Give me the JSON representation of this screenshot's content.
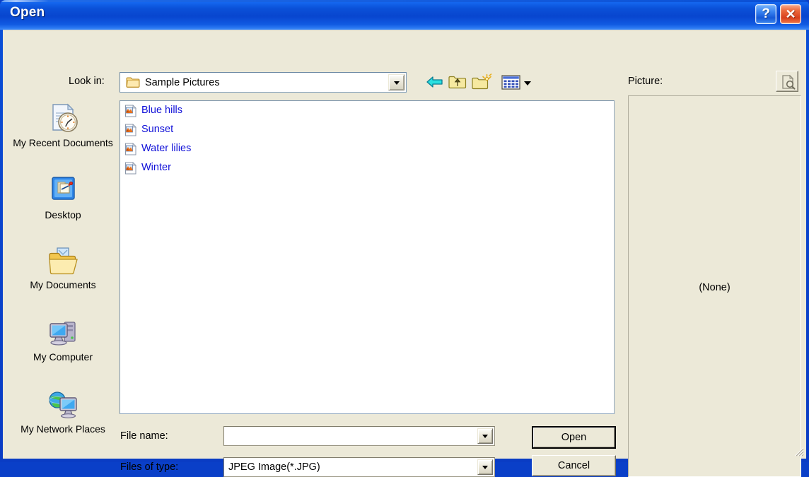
{
  "window": {
    "title": "Open",
    "help_button": "?",
    "close_button": "✕",
    "accent_titlebar": "#0b51d8",
    "dialog_background": "#ece9d8",
    "link_color": "#1010d8"
  },
  "toolbar": {
    "lookin_label": "Look in:",
    "lookin_value": "Sample Pictures",
    "buttons": [
      {
        "name": "back-button",
        "icon": "back-arrow-icon",
        "tooltip": "Back"
      },
      {
        "name": "up-one-level-button",
        "icon": "up-folder-icon",
        "tooltip": "Up One Level"
      },
      {
        "name": "create-new-folder-button",
        "icon": "new-folder-icon",
        "tooltip": "Create New Folder"
      },
      {
        "name": "views-button",
        "icon": "views-grid-icon",
        "tooltip": "Views"
      }
    ]
  },
  "places_bar": {
    "items": [
      {
        "label": "My Recent Documents",
        "icon": "recent-documents-icon"
      },
      {
        "label": "Desktop",
        "icon": "desktop-icon"
      },
      {
        "label": "My Documents",
        "icon": "my-documents-folder-icon"
      },
      {
        "label": "My Computer",
        "icon": "my-computer-icon"
      },
      {
        "label": "My Network Places",
        "icon": "network-places-icon"
      }
    ]
  },
  "file_list": {
    "items": [
      {
        "name": "Blue hills",
        "icon": "jpeg-image-icon"
      },
      {
        "name": "Sunset",
        "icon": "jpeg-image-icon"
      },
      {
        "name": "Water lilies",
        "icon": "jpeg-image-icon"
      },
      {
        "name": "Winter",
        "icon": "jpeg-image-icon"
      }
    ]
  },
  "preview": {
    "label": "Picture:",
    "empty_text": "(None)",
    "toggle_icon": "preview-magnifier-icon"
  },
  "fields": {
    "filename_label": "File name:",
    "filename_value": "",
    "filename_placeholder": "",
    "filetype_label": "Files of type:",
    "filetype_value": "JPEG Image(*.JPG)"
  },
  "actions": {
    "open_label": "Open",
    "cancel_label": "Cancel"
  }
}
